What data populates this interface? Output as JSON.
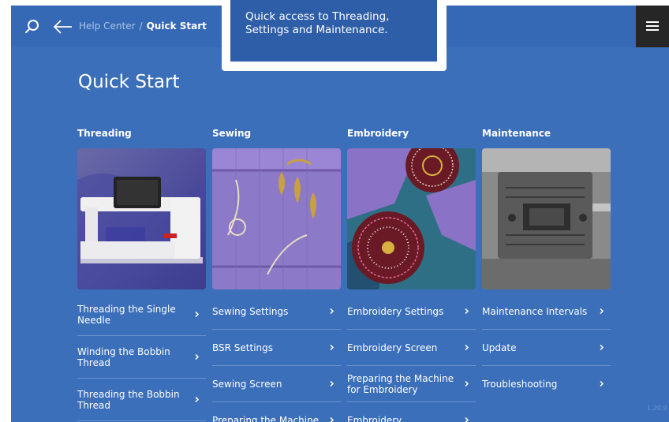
{
  "header": {
    "breadcrumb_home": "Help Center",
    "breadcrumb_separator": "/",
    "breadcrumb_current": "Quick Start"
  },
  "tooltip": {
    "line1": "Quick access to Threading,",
    "line2": "Settings and Maintenance."
  },
  "page_title": "Quick Start",
  "columns": [
    {
      "title": "Threading",
      "image": "sewing-machine-photo",
      "items": [
        "Threading the Single Needle",
        "Winding the Bobbin Thread",
        "Threading the Bobbin Thread"
      ]
    },
    {
      "title": "Sewing",
      "image": "embroidered-fabric-photo",
      "items": [
        "Sewing Settings",
        "BSR Settings",
        "Sewing Screen",
        "Preparing the Machine"
      ]
    },
    {
      "title": "Embroidery",
      "image": "embroidery-hoops-photo",
      "items": [
        "Embroidery Settings",
        "Embroidery Screen",
        "Preparing the Machine for Embroidery",
        "Embroidery"
      ]
    },
    {
      "title": "Maintenance",
      "image": "presser-foot-closeup-photo",
      "items": [
        "Maintenance Intervals",
        "Update",
        "Troubleshooting"
      ]
    }
  ],
  "version": "1.20.9",
  "colors": {
    "background": "#3b6fba",
    "topbar": "#3568b5",
    "tooltip": "#2e5ea8",
    "menu_button": "#262626",
    "divider": "#6a92cf"
  }
}
